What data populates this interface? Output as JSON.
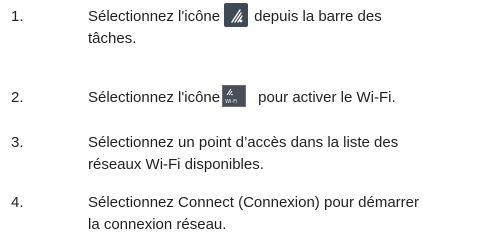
{
  "steps": [
    {
      "number": "1.",
      "line1_before": "Sélectionnez l'icône",
      "line1_after": "depuis la barre des",
      "line2": "tâches.",
      "icon": "wifi-taskbar-icon"
    },
    {
      "number": "2.",
      "line1_before": "Sélectionnez l'icône",
      "line1_after": "pour activer le Wi-Fi.",
      "icon": "wifi-toggle-icon",
      "icon_label": "Wi-Fi"
    },
    {
      "number": "3.",
      "line1": "Sélectionnez un point d’accès dans la liste des",
      "line2": "réseaux Wi-Fi disponibles."
    },
    {
      "number": "4.",
      "line1": "Sélectionnez Connect (Connexion) pour démarrer",
      "line2": "la connexion réseau."
    }
  ],
  "colors": {
    "text": "#231f20",
    "icon_tile": "#3f4a56",
    "icon_glyph": "#ffffff"
  }
}
